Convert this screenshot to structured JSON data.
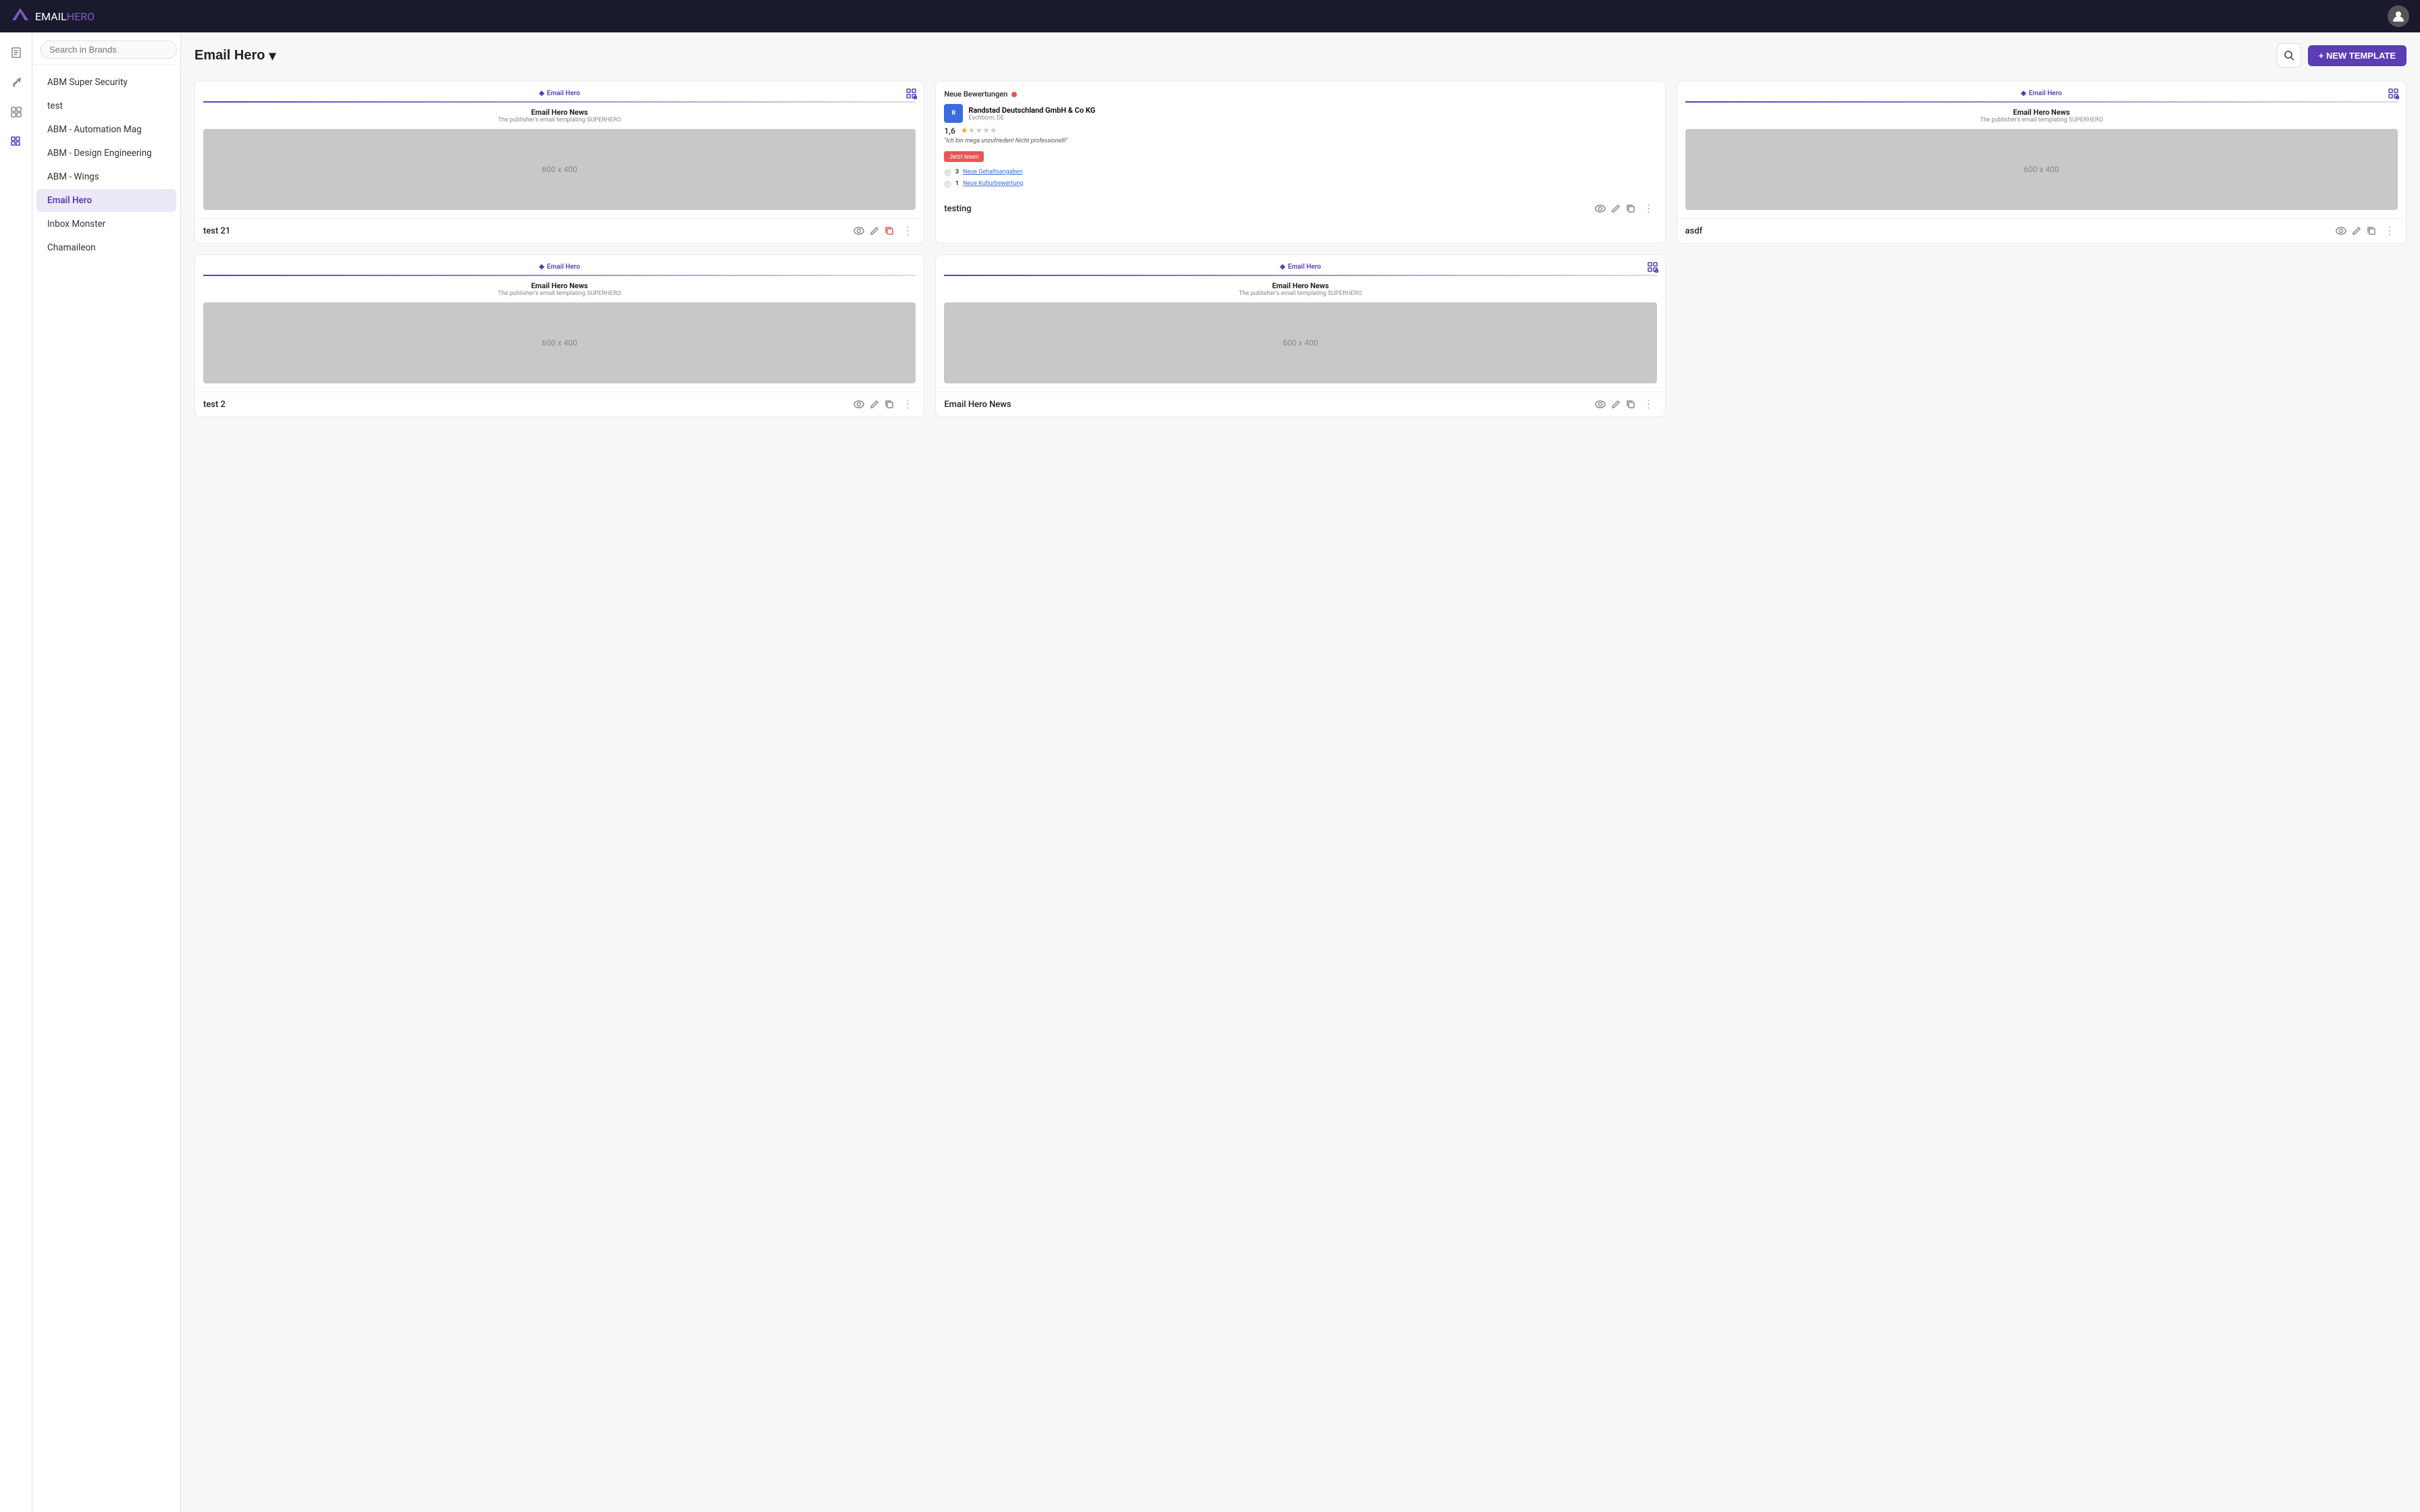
{
  "app": {
    "name_email": "EMAIL",
    "name_hero": "HERO",
    "avatar_label": "user avatar"
  },
  "topnav": {
    "logo_text": "EMAILHERO"
  },
  "icon_sidebar": {
    "items": [
      {
        "id": "doc-icon",
        "symbol": "📄"
      },
      {
        "id": "tool-icon",
        "symbol": "🔧"
      },
      {
        "id": "table-icon",
        "symbol": "📊"
      },
      {
        "id": "grid-icon",
        "symbol": "⊞"
      }
    ]
  },
  "brands_sidebar": {
    "search_placeholder": "Search in Brands",
    "add_button_label": "+",
    "brands": [
      {
        "id": "abm-super-security",
        "label": "ABM Super Security",
        "active": false
      },
      {
        "id": "test",
        "label": "test",
        "active": false
      },
      {
        "id": "abm-automation",
        "label": "ABM - Automation Mag",
        "active": false
      },
      {
        "id": "abm-design",
        "label": "ABM - Design Engineering",
        "active": false
      },
      {
        "id": "abm-wings",
        "label": "ABM - Wings",
        "active": false
      },
      {
        "id": "email-hero",
        "label": "Email Hero",
        "active": true
      },
      {
        "id": "inbox-monster",
        "label": "Inbox Monster",
        "active": false
      },
      {
        "id": "chamaileon",
        "label": "Chamaileon",
        "active": false
      }
    ]
  },
  "main": {
    "brand_title": "Email Hero",
    "dropdown_icon": "▾",
    "new_template_label": "+ NEW TEMPLATE",
    "templates": [
      {
        "id": "test21",
        "brand_label": "Email Hero",
        "card_title": "Email Hero News",
        "card_subtitle": "The publisher's email templating SUPERHERO",
        "image_label": "600 x 400",
        "name": "test 21",
        "has_corner_icon": true,
        "corner_icon": "⊞",
        "type": "standard",
        "copy_active": true
      },
      {
        "id": "testing",
        "brand_label": null,
        "card_title": null,
        "card_subtitle": null,
        "image_label": null,
        "name": "testing",
        "has_corner_icon": false,
        "type": "review",
        "review": {
          "badge_text": "Neue Bewertungen",
          "dot": true,
          "company_name": "Randstad Deutschland GmbH & Co KG",
          "company_loc": "Eschborn, DE",
          "rating": "1,6",
          "stars_filled": 1,
          "stars_total": 5,
          "quote": "\"Ich bin mega unzufrieden! Nicht professionell!\"",
          "read_btn": "Jetzt lesen",
          "stats": [
            {
              "num": "3",
              "link_text": "Neue Gehaltsangaben"
            },
            {
              "num": "1",
              "link_text": "Neue Kulturbewertung"
            }
          ]
        }
      },
      {
        "id": "asdf",
        "brand_label": "Email Hero",
        "card_title": "Email Hero News",
        "card_subtitle": "The publisher's email templating SUPERHERO",
        "image_label": "600 x 400",
        "name": "asdf",
        "has_corner_icon": true,
        "corner_icon": "⊞",
        "type": "standard"
      },
      {
        "id": "test2",
        "brand_label": "Email Hero",
        "card_title": "Email Hero News",
        "card_subtitle": "The publisher's email templating SUPERHERO",
        "image_label": "600 x 400",
        "name": "test 2",
        "has_corner_icon": false,
        "type": "standard"
      },
      {
        "id": "email-hero-news",
        "brand_label": "Email Hero",
        "card_title": "Email Hero News",
        "card_subtitle": "The publisher's email templating SUPERHERO",
        "image_label": "600 x 400",
        "name": "Email Hero News",
        "has_corner_icon": true,
        "corner_icon": "⊞",
        "type": "standard"
      }
    ]
  },
  "icons": {
    "eye": "👁",
    "pencil": "✏",
    "copy": "⧉",
    "more": "⋮",
    "search": "🔍",
    "diamond": "◆"
  }
}
